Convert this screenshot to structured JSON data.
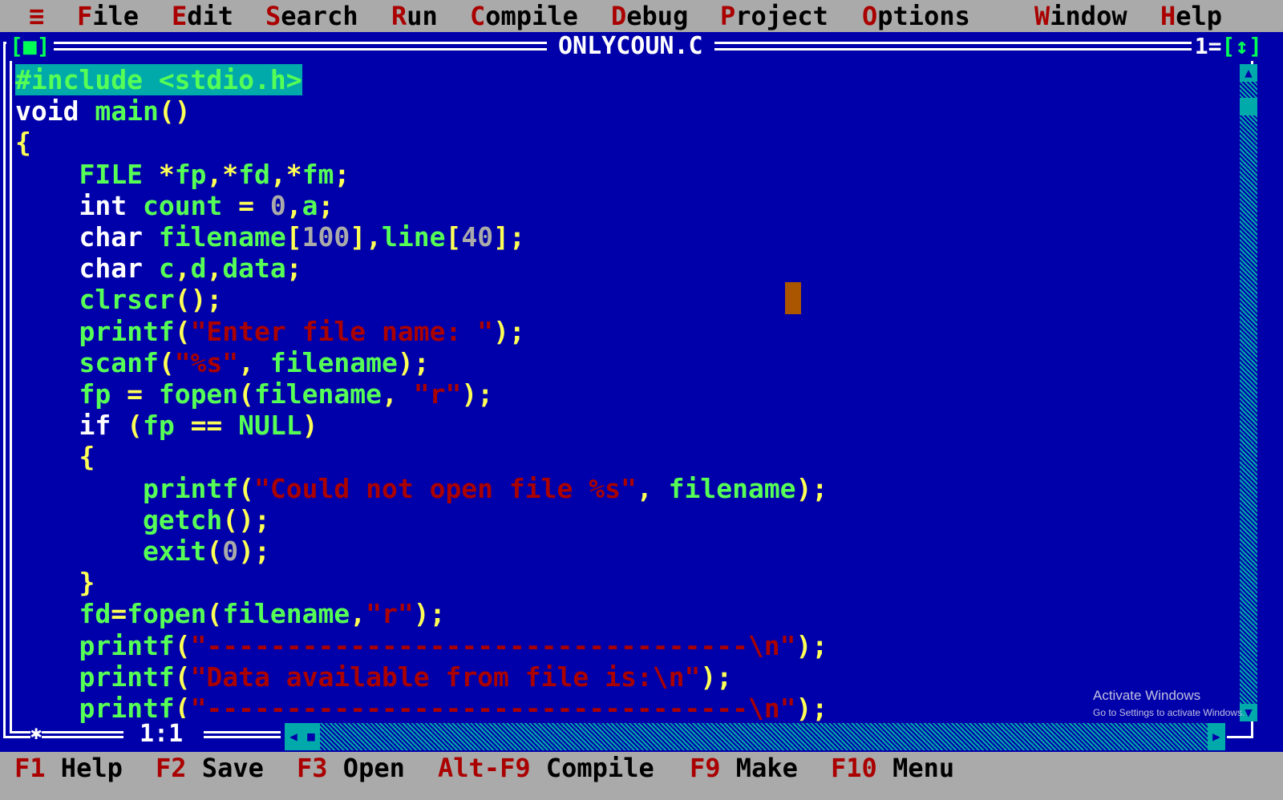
{
  "menu": {
    "system": "≡",
    "items": [
      {
        "hot": "F",
        "rest": "ile"
      },
      {
        "hot": "E",
        "rest": "dit"
      },
      {
        "hot": "S",
        "rest": "earch"
      },
      {
        "hot": "R",
        "rest": "un"
      },
      {
        "hot": "C",
        "rest": "ompile"
      },
      {
        "hot": "D",
        "rest": "ebug"
      },
      {
        "hot": "P",
        "rest": "roject"
      },
      {
        "hot": "O",
        "rest": "ptions"
      },
      {
        "hot": "W",
        "rest": "indow"
      },
      {
        "hot": "H",
        "rest": "elp"
      }
    ]
  },
  "window": {
    "title": "ONLYCOUN.C",
    "close_box": "[■]",
    "number": "1",
    "zoom_box": "[↕]",
    "cursor_position": "1:1"
  },
  "code_lines": [
    [
      [
        "pp",
        "#include <stdio.h>"
      ]
    ],
    [
      [
        "kw",
        "void "
      ],
      [
        "id",
        "main"
      ],
      [
        "sy",
        "()"
      ]
    ],
    [
      [
        "sy",
        "{"
      ]
    ],
    [
      [
        "id",
        "    FILE "
      ],
      [
        "sy",
        "*"
      ],
      [
        "id",
        "fp"
      ],
      [
        "sy",
        ",*"
      ],
      [
        "id",
        "fd"
      ],
      [
        "sy",
        ",*"
      ],
      [
        "id",
        "fm"
      ],
      [
        "sy",
        ";"
      ]
    ],
    [
      [
        "kw",
        "    int "
      ],
      [
        "id",
        "count "
      ],
      [
        "sy",
        "= "
      ],
      [
        "nm",
        "0"
      ],
      [
        "sy",
        ","
      ],
      [
        "id",
        "a"
      ],
      [
        "sy",
        ";"
      ]
    ],
    [
      [
        "kw",
        "    char "
      ],
      [
        "id",
        "filename"
      ],
      [
        "sy",
        "["
      ],
      [
        "nm",
        "100"
      ],
      [
        "sy",
        "],"
      ],
      [
        "id",
        "line"
      ],
      [
        "sy",
        "["
      ],
      [
        "nm",
        "40"
      ],
      [
        "sy",
        "];"
      ]
    ],
    [
      [
        "kw",
        "    char "
      ],
      [
        "id",
        "c"
      ],
      [
        "sy",
        ","
      ],
      [
        "id",
        "d"
      ],
      [
        "sy",
        ","
      ],
      [
        "id",
        "data"
      ],
      [
        "sy",
        ";"
      ]
    ],
    [
      [
        "id",
        "    clrscr"
      ],
      [
        "sy",
        "();"
      ]
    ],
    [
      [
        "id",
        "    printf"
      ],
      [
        "sy",
        "("
      ],
      [
        "st",
        "\"Enter file name: \""
      ],
      [
        "sy",
        ");"
      ]
    ],
    [
      [
        "id",
        "    scanf"
      ],
      [
        "sy",
        "("
      ],
      [
        "st",
        "\"%s\""
      ],
      [
        "sy",
        ", "
      ],
      [
        "id",
        "filename"
      ],
      [
        "sy",
        ");"
      ]
    ],
    [
      [
        "id",
        "    fp "
      ],
      [
        "sy",
        "= "
      ],
      [
        "id",
        "fopen"
      ],
      [
        "sy",
        "("
      ],
      [
        "id",
        "filename"
      ],
      [
        "sy",
        ", "
      ],
      [
        "st",
        "\"r\""
      ],
      [
        "sy",
        ");"
      ]
    ],
    [
      [
        "kw",
        "    if "
      ],
      [
        "sy",
        "("
      ],
      [
        "id",
        "fp "
      ],
      [
        "sy",
        "== "
      ],
      [
        "id",
        "NULL"
      ],
      [
        "sy",
        ")"
      ]
    ],
    [
      [
        "sy",
        "    {"
      ]
    ],
    [
      [
        "id",
        "        printf"
      ],
      [
        "sy",
        "("
      ],
      [
        "st",
        "\"Could not open file %s\""
      ],
      [
        "sy",
        ", "
      ],
      [
        "id",
        "filename"
      ],
      [
        "sy",
        ");"
      ]
    ],
    [
      [
        "id",
        "        getch"
      ],
      [
        "sy",
        "();"
      ]
    ],
    [
      [
        "id",
        "        exit"
      ],
      [
        "sy",
        "("
      ],
      [
        "nm",
        "0"
      ],
      [
        "sy",
        ");"
      ]
    ],
    [
      [
        "sy",
        "    }"
      ]
    ],
    [
      [
        "id",
        "    fd"
      ],
      [
        "sy",
        "="
      ],
      [
        "id",
        "fopen"
      ],
      [
        "sy",
        "("
      ],
      [
        "id",
        "filename"
      ],
      [
        "sy",
        ","
      ],
      [
        "st",
        "\"r\""
      ],
      [
        "sy",
        ");"
      ]
    ],
    [
      [
        "id",
        "    printf"
      ],
      [
        "sy",
        "("
      ],
      [
        "st",
        "\"----------------------------------\\n\""
      ],
      [
        "sy",
        ");"
      ]
    ],
    [
      [
        "id",
        "    printf"
      ],
      [
        "sy",
        "("
      ],
      [
        "st",
        "\"Data available from file is:\\n\""
      ],
      [
        "sy",
        ");"
      ]
    ],
    [
      [
        "id",
        "    printf"
      ],
      [
        "sy",
        "("
      ],
      [
        "st",
        "\"----------------------------------\\n\""
      ],
      [
        "sy",
        ");"
      ]
    ]
  ],
  "fkeys": [
    {
      "key": "F1",
      "label": " Help"
    },
    {
      "key": "F2",
      "label": " Save"
    },
    {
      "key": "F3",
      "label": " Open"
    },
    {
      "key": "Alt-F9",
      "label": " Compile"
    },
    {
      "key": "F9",
      "label": " Make"
    },
    {
      "key": "F10",
      "label": " Menu"
    }
  ],
  "watermark": {
    "line1": "Activate Windows",
    "line2": "Go to Settings to activate Windows."
  },
  "colors": {
    "background": "#0000AA",
    "menu_bar": "#AAAAAA",
    "hotkey": "#AA0000",
    "identifier": "#55FF55",
    "keyword": "#FFFFFF",
    "symbol": "#FFFF55",
    "string": "#AA0000",
    "number": "#AAAAAA",
    "selection": "#00AAAA",
    "cursor_block": "#AA5500"
  },
  "icons": {
    "system_menu": "hamburger-icon",
    "scroll_up": "arrow-up-icon",
    "scroll_down": "arrow-down-icon",
    "scroll_left": "arrow-left-icon",
    "scroll_right": "arrow-right-icon",
    "resize": "resize-corner-icon"
  }
}
